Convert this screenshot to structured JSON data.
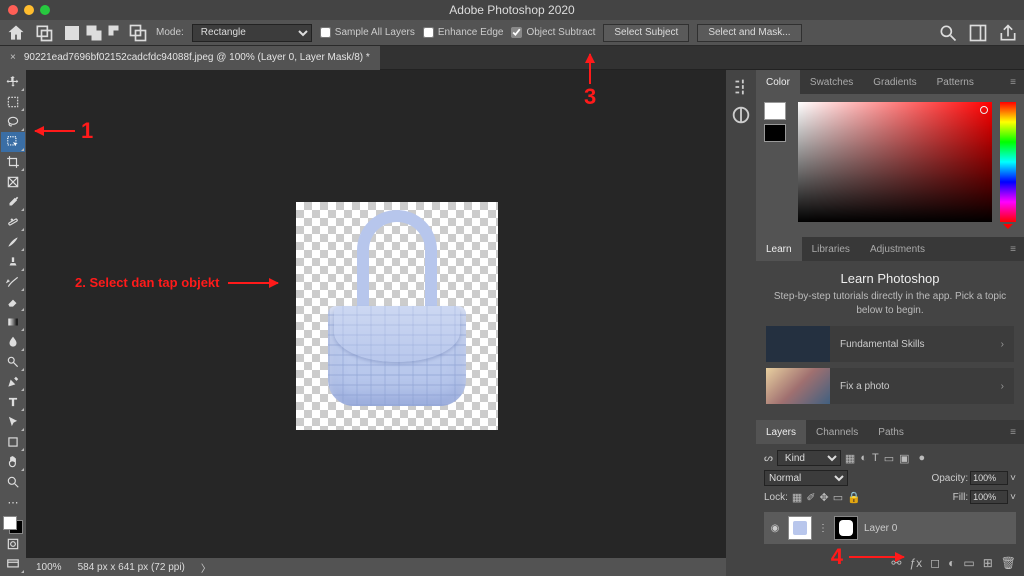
{
  "app_title": "Adobe Photoshop 2020",
  "document_tab": "90221ead7696bf02152cadcfdc94088f.jpeg @ 100% (Layer 0, Layer Mask/8) *",
  "options_bar": {
    "mode_label": "Mode:",
    "mode_value": "Rectangle",
    "sample_all_layers": {
      "label": "Sample All Layers",
      "checked": false
    },
    "enhance_edge": {
      "label": "Enhance Edge",
      "checked": false
    },
    "object_subtract": {
      "label": "Object Subtract",
      "checked": true
    },
    "select_subject": "Select Subject",
    "select_and_mask": "Select and Mask..."
  },
  "status_bar": {
    "zoom": "100%",
    "doc_info": "584 px x 641 px (72 ppi)"
  },
  "color_panel": {
    "tabs": [
      "Color",
      "Swatches",
      "Gradients",
      "Patterns"
    ],
    "active": 0
  },
  "mid_panel": {
    "tabs": [
      "Learn",
      "Libraries",
      "Adjustments"
    ],
    "active": 0,
    "title": "Learn Photoshop",
    "sub": "Step-by-step tutorials directly in the app. Pick a topic below to begin.",
    "cards": [
      "Fundamental Skills",
      "Fix a photo"
    ]
  },
  "layers_panel": {
    "tabs": [
      "Layers",
      "Channels",
      "Paths"
    ],
    "active": 0,
    "kind": "Kind",
    "blend_mode": "Normal",
    "opacity_label": "Opacity:",
    "opacity_value": "100%",
    "lock_label": "Lock:",
    "fill_label": "Fill:",
    "fill_value": "100%",
    "layer_name": "Layer 0"
  },
  "annotations": {
    "n1": "1",
    "n2": "2. Select dan tap objekt",
    "n3": "3",
    "n4": "4"
  }
}
